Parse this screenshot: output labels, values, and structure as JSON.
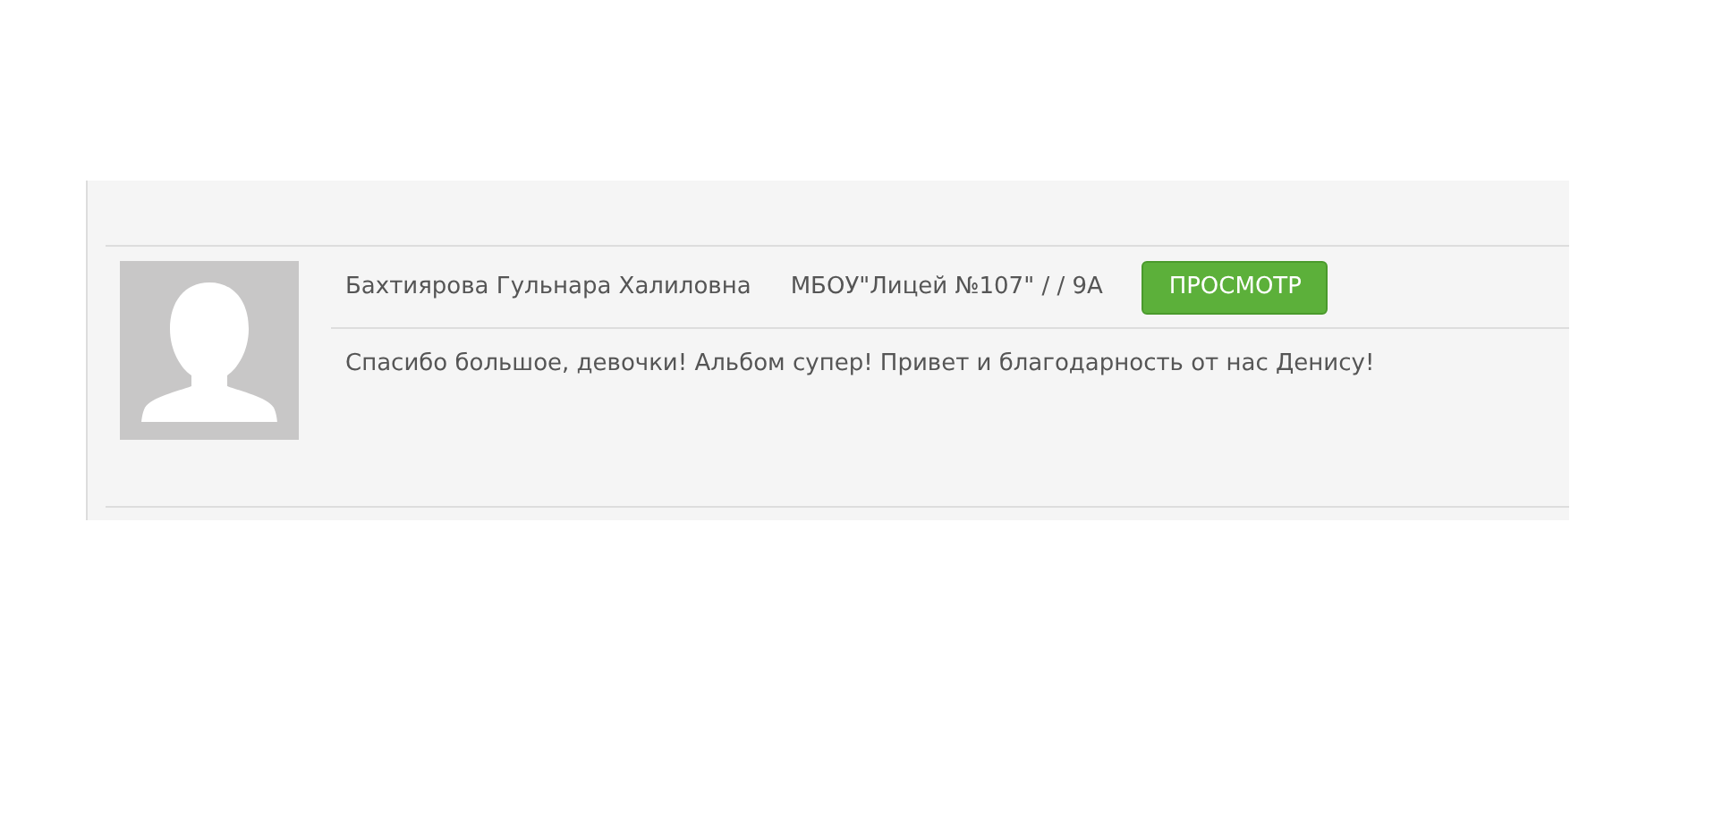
{
  "reviews": [
    {
      "author": "Бахтиярова Гульнара Халиловна",
      "school": "МБОУ\"Лицей №107\" / / 9А",
      "button": "ПРОСМОТР",
      "comment": "Спасибо большое, девочки! Альбом супер! Привет и благодарность от нас Денису!"
    }
  ]
}
